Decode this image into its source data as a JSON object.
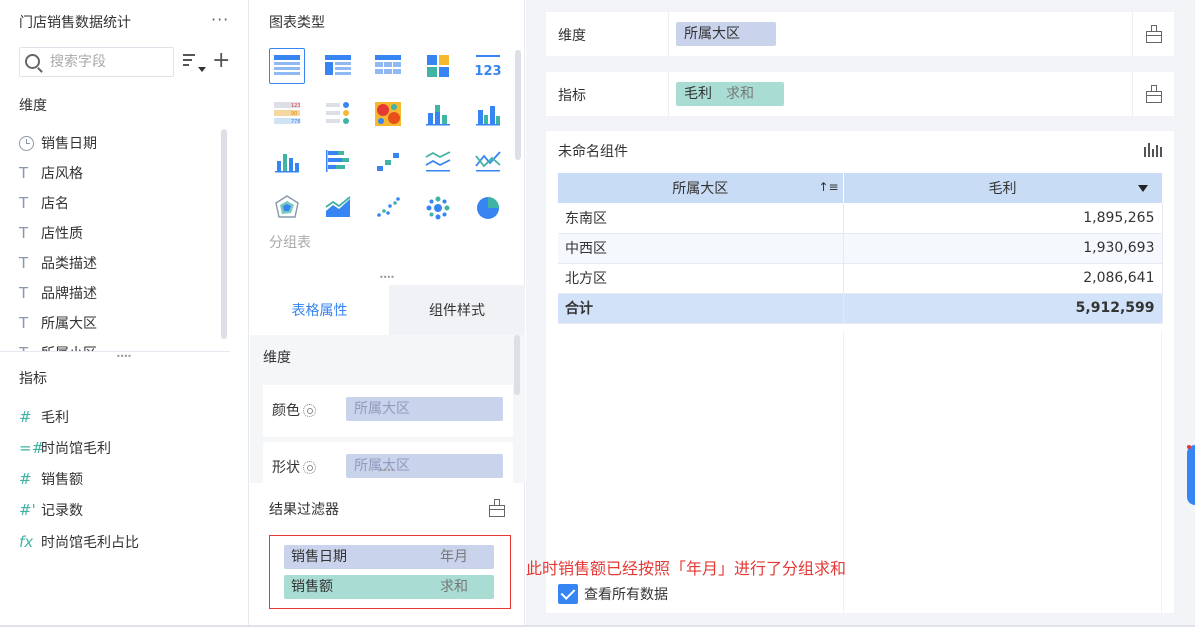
{
  "dataset": {
    "title": "门店销售数据统计",
    "more": "···",
    "search_placeholder": "搜索字段",
    "dimension_label": "维度",
    "dimensions": [
      "销售日期",
      "店风格",
      "店名",
      "店性质",
      "品类描述",
      "品牌描述",
      "所属大区",
      "所属小区"
    ],
    "indicator_label": "指标",
    "indicators": [
      {
        "icon": "#",
        "label": "毛利"
      },
      {
        "icon": "=#",
        "label": "时尚馆毛利"
      },
      {
        "icon": "#",
        "label": "销售额"
      },
      {
        "icon": "#'",
        "label": "记录数"
      },
      {
        "icon": "fx",
        "label": "时尚馆毛利占比"
      }
    ]
  },
  "chart_types": {
    "title": "图表类型",
    "group_table_label": "分组表",
    "selected": "grouped-table"
  },
  "tabs": {
    "table_props": "表格属性",
    "component_style": "组件样式"
  },
  "props": {
    "dimension_label": "维度",
    "color_label": "颜色",
    "color_value": "所属大区",
    "shape_label": "形状",
    "shape_value": "所属大区"
  },
  "result_filter": {
    "title": "结果过滤器",
    "items": [
      {
        "label": "销售日期",
        "agg": "年月"
      },
      {
        "label": "销售额",
        "agg": "求和"
      }
    ]
  },
  "shelves": {
    "dimension_label": "维度",
    "dimension_value": "所属大区",
    "indicator_label": "指标",
    "indicator_value": "毛利",
    "indicator_agg": "求和"
  },
  "widget": {
    "title": "未命名组件",
    "columns": [
      "所属大区",
      "毛利"
    ],
    "rows": [
      {
        "region": "东南区",
        "value": "1,895,265"
      },
      {
        "region": "中西区",
        "value": "1,930,693"
      },
      {
        "region": "北方区",
        "value": "2,086,641"
      }
    ],
    "total": {
      "label": "合计",
      "value": "5,912,599"
    }
  },
  "annotation": "此时销售额已经按照「年月」进行了分组求和",
  "view_all": {
    "label": "查看所有数据",
    "checked": true
  },
  "colors": {
    "accent": "#3685f2",
    "dimension_pill": "#c9d3ec",
    "indicator_pill": "#a9ddd4",
    "header": "#c9dcf5",
    "annotation": "#e53935"
  }
}
